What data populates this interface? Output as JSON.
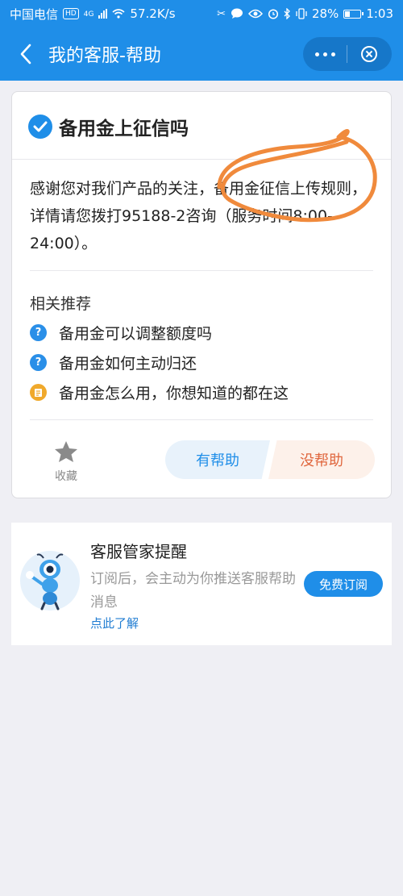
{
  "status_bar": {
    "carrier": "中国电信",
    "hd": "HD",
    "network": "4G",
    "speed": "57.2K/s",
    "battery": "28%",
    "time": "1:03"
  },
  "nav": {
    "title": "我的客服-帮助",
    "back_icon": "chevron-left-icon",
    "more_icon": "more-dots-icon",
    "close_icon": "close-circle-icon"
  },
  "question": {
    "title": "备用金上征信吗",
    "answer": "感谢您对我们产品的关注，备用金征信上传规则，详情请您拨打95188-2咨询（服务时间8:00-24:00）。"
  },
  "related": {
    "title": "相关推荐",
    "items": [
      {
        "label": "备用金可以调整额度吗",
        "icon": "question-circle-icon",
        "color": "#2a8fe8"
      },
      {
        "label": "备用金如何主动归还",
        "icon": "question-circle-icon",
        "color": "#2a8fe8"
      },
      {
        "label": "备用金怎么用，你想知道的都在这",
        "icon": "document-icon",
        "color": "#f0a92c"
      }
    ]
  },
  "feedback": {
    "favorite_label": "收藏",
    "helpful_label": "有帮助",
    "not_helpful_label": "没帮助"
  },
  "subscribe": {
    "title": "客服管家提醒",
    "description": "订阅后，会主动为你推送客服帮助消息",
    "link": "点此了解",
    "button": "免费订阅"
  },
  "colors": {
    "primary": "#1f8ee8",
    "annotation": "#f08a3c",
    "not_helpful": "#e0663d"
  }
}
